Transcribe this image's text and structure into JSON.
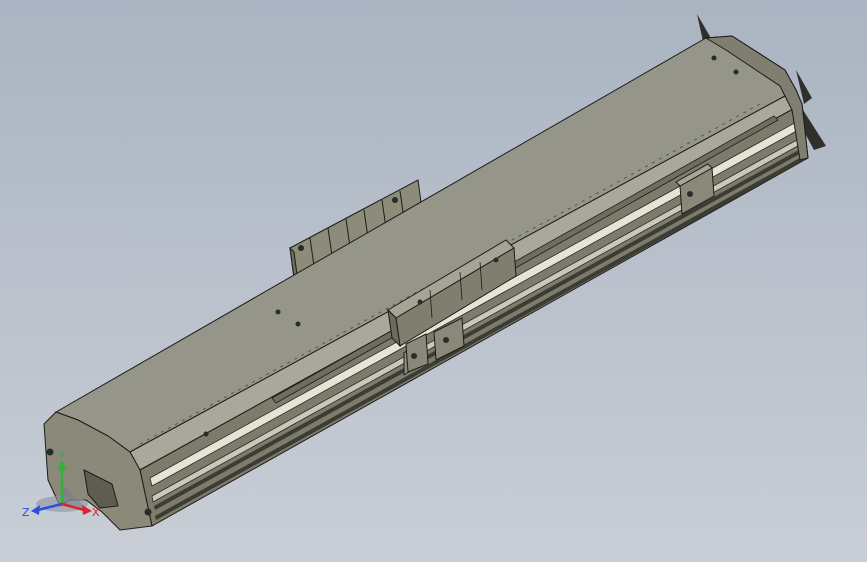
{
  "viewport": {
    "background_top": "#aab4c2",
    "background_bottom": "#c9ced6"
  },
  "model": {
    "part_color": "#8f8e7c",
    "edge_color": "#1b1b18"
  },
  "triad": {
    "x_label": "X",
    "y_label": "Y",
    "z_label": "Z",
    "x_color": "#d8262a",
    "y_color": "#2fb33d",
    "z_color": "#2850d8"
  }
}
